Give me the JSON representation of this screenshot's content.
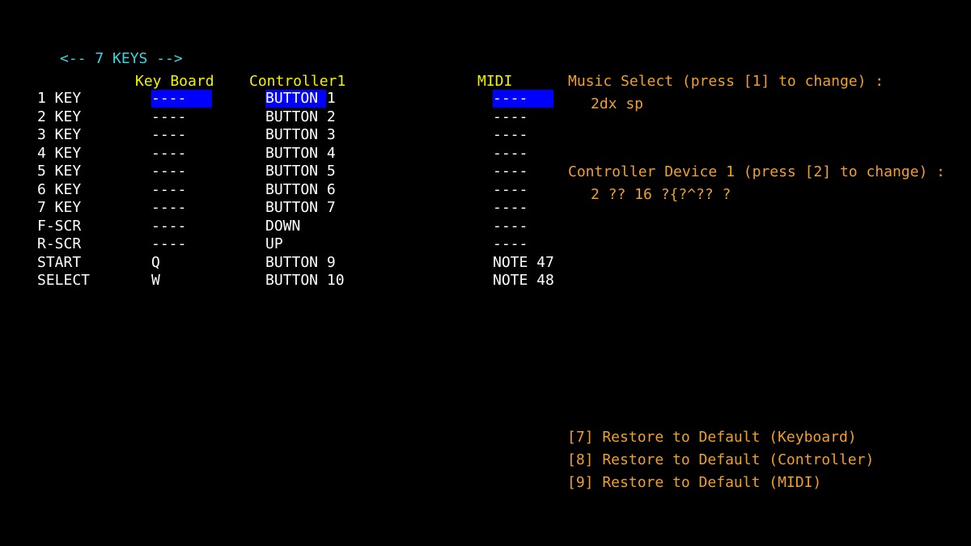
{
  "mode_nav": "<-- 7 KEYS -->",
  "headers": {
    "keyboard": "Key Board",
    "controller": "Controller1",
    "midi": "MIDI"
  },
  "rows": [
    {
      "label": "1 KEY",
      "keyboard": "----",
      "controller": "BUTTON 1",
      "midi": "----"
    },
    {
      "label": "2 KEY",
      "keyboard": "----",
      "controller": "BUTTON 2",
      "midi": "----"
    },
    {
      "label": "3 KEY",
      "keyboard": "----",
      "controller": "BUTTON 3",
      "midi": "----"
    },
    {
      "label": "4 KEY",
      "keyboard": "----",
      "controller": "BUTTON 4",
      "midi": "----"
    },
    {
      "label": "5 KEY",
      "keyboard": "----",
      "controller": "BUTTON 5",
      "midi": "----"
    },
    {
      "label": "6 KEY",
      "keyboard": "----",
      "controller": "BUTTON 6",
      "midi": "----"
    },
    {
      "label": "7 KEY",
      "keyboard": "----",
      "controller": "BUTTON 7",
      "midi": "----"
    },
    {
      "label": "F-SCR",
      "keyboard": "----",
      "controller": "DOWN",
      "midi": "----"
    },
    {
      "label": "R-SCR",
      "keyboard": "----",
      "controller": "UP",
      "midi": "----"
    },
    {
      "label": "START",
      "keyboard": "Q",
      "controller": "BUTTON 9",
      "midi": "NOTE 47"
    },
    {
      "label": "SELECT",
      "keyboard": "W",
      "controller": "BUTTON 10",
      "midi": "NOTE 48"
    }
  ],
  "music_select": {
    "title": "Music Select (press [1] to change) :",
    "value": "2dx sp"
  },
  "controller_device": {
    "title": "Controller Device 1 (press [2] to change) :",
    "value": "2 ?? 16 ?{?^?? ?"
  },
  "restore": {
    "keyboard": "[7] Restore to Default (Keyboard)",
    "controller": "[8] Restore to Default (Controller)",
    "midi": "[9] Restore to Default (MIDI)"
  },
  "colors": {
    "background": "#000000",
    "nav": "#3ad4e0",
    "header": "#f2f200",
    "info": "#ef9f2b",
    "selection": "#0000ff",
    "text": "#ffffff"
  }
}
